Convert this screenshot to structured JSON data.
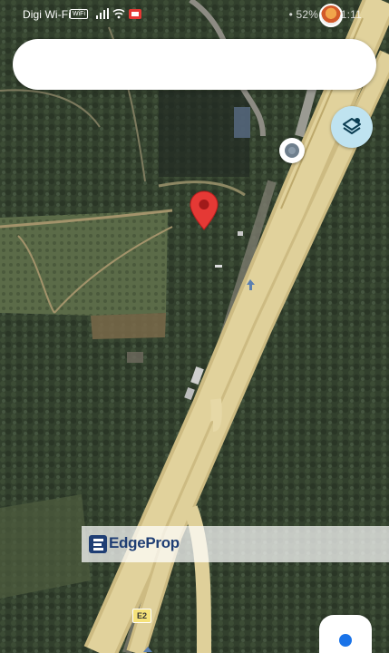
{
  "status_bar": {
    "carrier": "Digi Wi-Fi",
    "wifi_badge": "WiFi",
    "right_text": "• 52% ▭ 11:11"
  },
  "search": {
    "placeholder": ""
  },
  "map": {
    "road_label": "E2",
    "watermark": "EdgeProp",
    "colors": {
      "highway": "#d8c98c",
      "pin": "#e53935",
      "layers_button": "#bfe3f0",
      "my_location": "#1a73e8"
    }
  },
  "icons": {
    "layers": "layers-icon",
    "pin": "red-location-pin-icon",
    "marker": "grey-place-marker-icon",
    "my_location": "my-location-icon"
  }
}
